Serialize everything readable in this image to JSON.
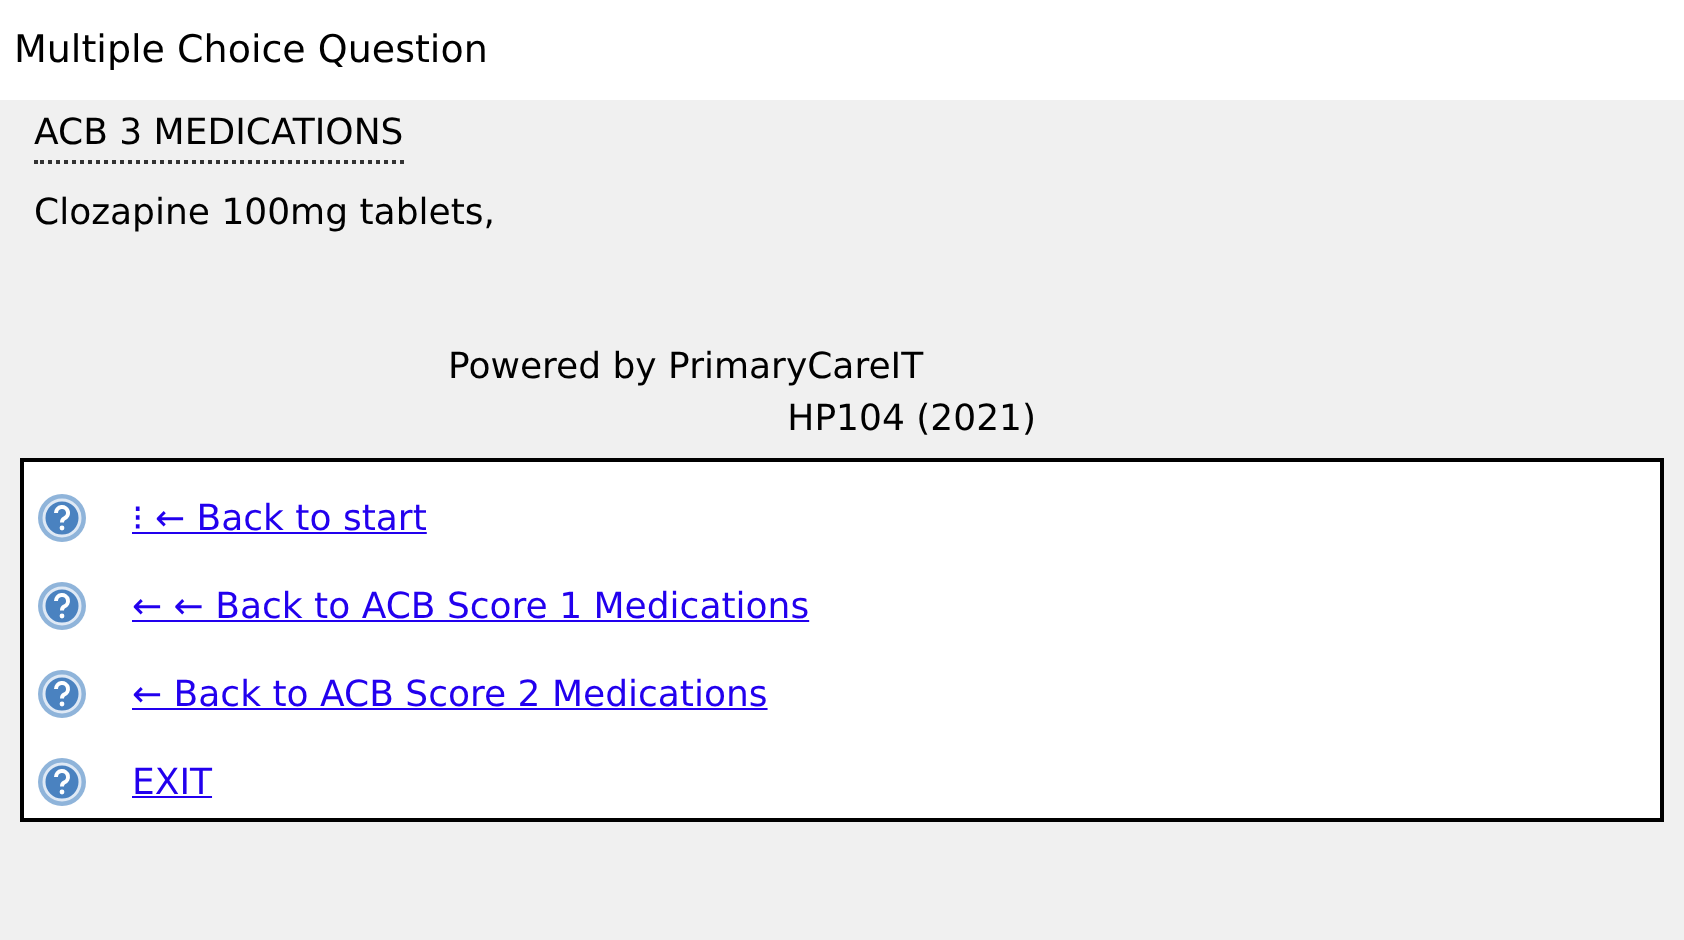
{
  "window": {
    "title": "Multiple Choice Question"
  },
  "heading": "ACB 3 MEDICATIONS",
  "body": "Clozapine 100mg tablets,",
  "footer": {
    "line_1": "Powered by PrimaryCareIT",
    "line_2": "HP104 (2021)"
  },
  "options": [
    {
      "label": "⁝ ← Back to start"
    },
    {
      "label": "← ← Back to ACB Score 1 Medications"
    },
    {
      "label": "← Back to ACB Score 2 Medications"
    },
    {
      "label": "EXIT"
    }
  ]
}
